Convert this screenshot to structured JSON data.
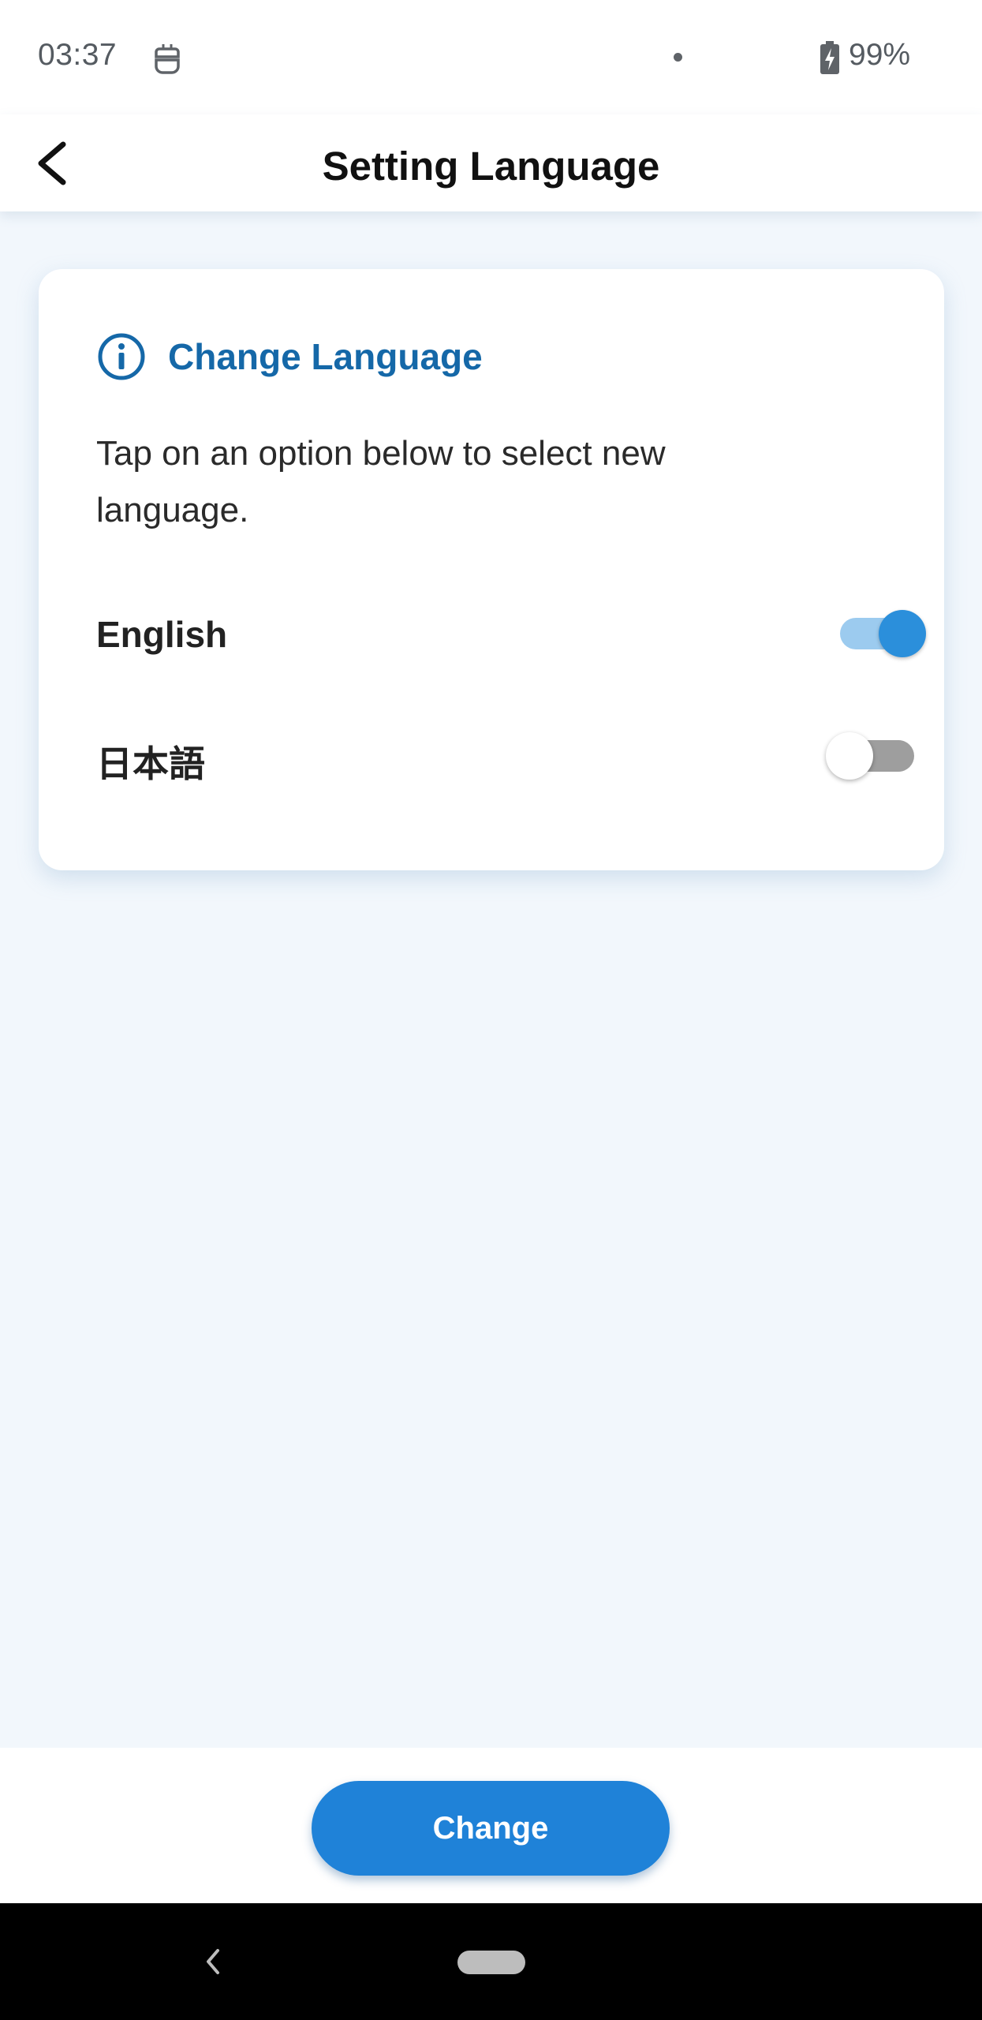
{
  "status_bar": {
    "time": "03:37",
    "app_icon": "robot-icon",
    "battery_icon": "battery-charging-icon",
    "battery_text": "99%"
  },
  "app_bar": {
    "back_icon": "back-arrow-icon",
    "title": "Setting Language"
  },
  "card": {
    "icon": "info-icon",
    "title": "Change Language",
    "description": "Tap on an option below to select new language.",
    "options": [
      {
        "label": "English",
        "enabled": true
      },
      {
        "label": "日本語",
        "enabled": false
      }
    ]
  },
  "footer": {
    "change_label": "Change"
  },
  "nav_bar": {
    "back_icon": "nav-back-icon",
    "home_icon": "home-pill-icon"
  },
  "colors": {
    "accent": "#1f82d8",
    "title_blue": "#1568a8",
    "background": "#f2f7fc"
  }
}
